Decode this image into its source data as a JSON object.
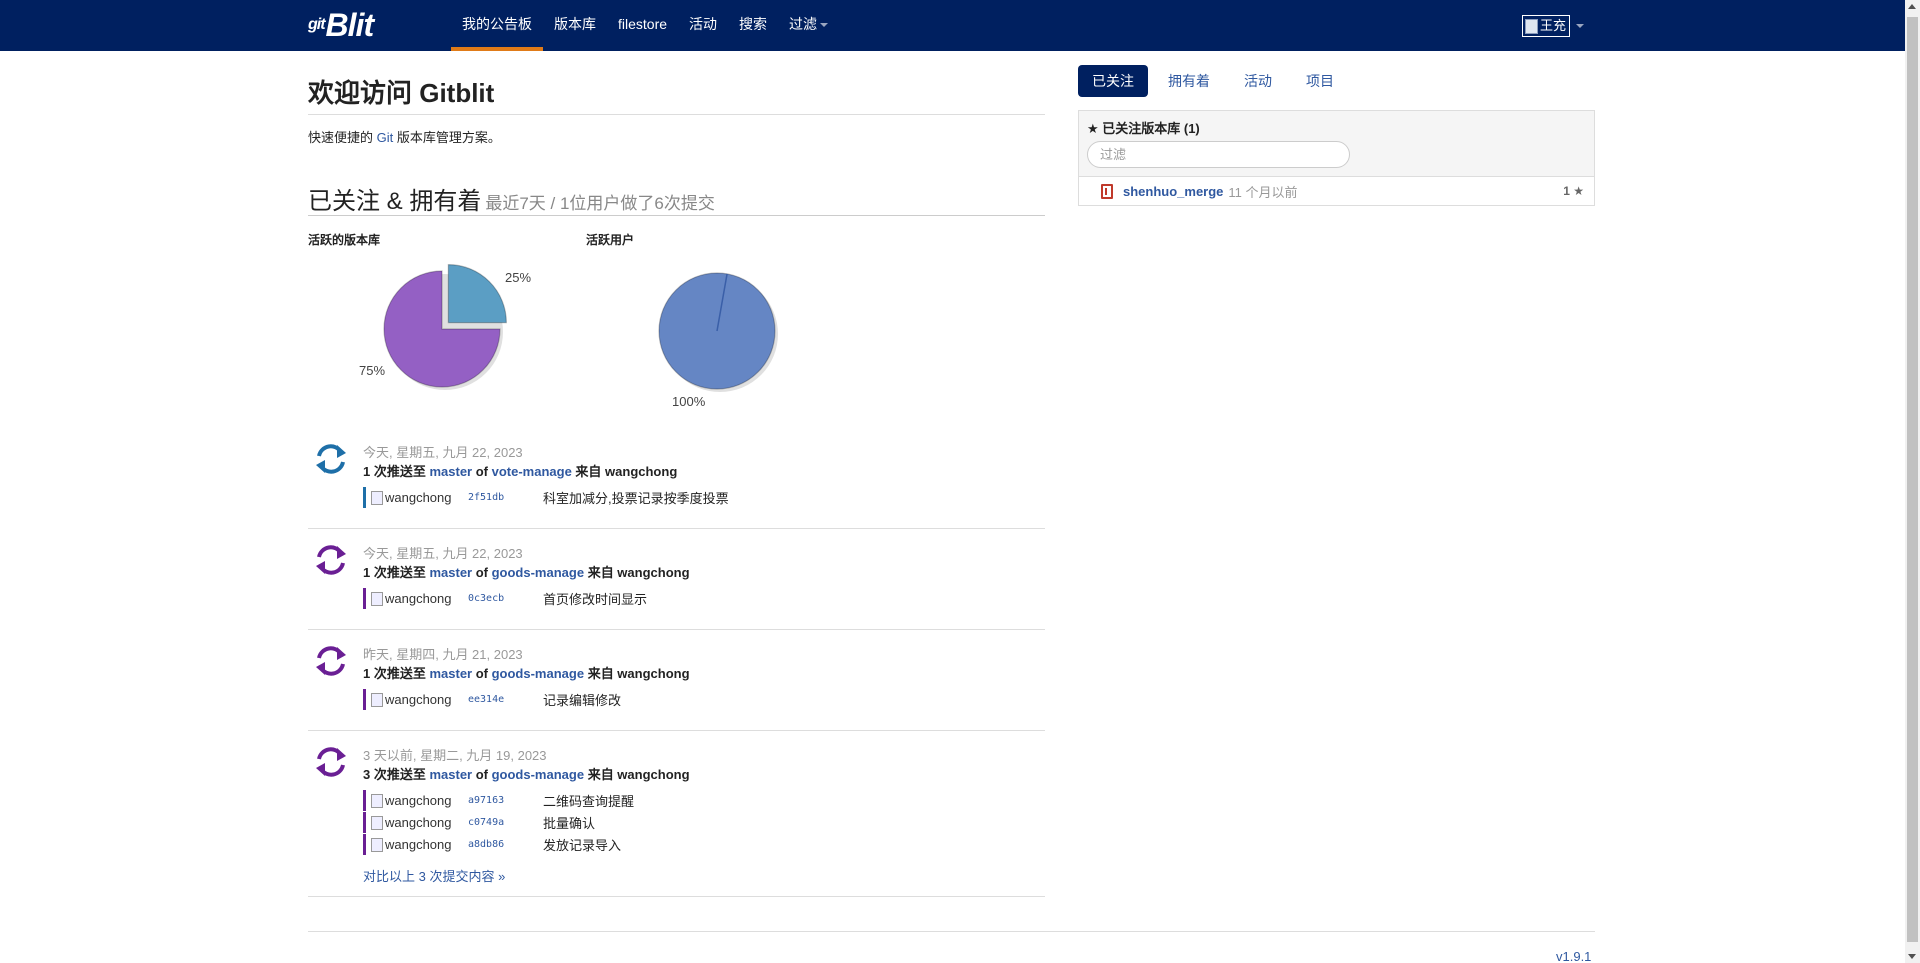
{
  "brand": {
    "prefix": "git",
    "name": "Blit"
  },
  "nav": {
    "items": [
      "我的公告板",
      "版本库",
      "filestore",
      "活动",
      "搜索",
      "过滤"
    ],
    "user_alt": "王充"
  },
  "main": {
    "title": "欢迎访问 Gitblit",
    "intro_before": "快速便捷的 ",
    "intro_link": "Git",
    "intro_after": " 版本库管理方案。",
    "section_title": "已关注 & 拥有着",
    "section_sub": "最近7天 / 1位用户做了6次提交"
  },
  "chart_data": [
    {
      "type": "pie",
      "title": "活跃的版本库",
      "labels": [
        "75%",
        "25%"
      ],
      "values": [
        75,
        25
      ],
      "colors": [
        "#9460c4",
        "#5b9ec4"
      ]
    },
    {
      "type": "pie",
      "title": "活跃用户",
      "labels": [
        "100%"
      ],
      "values": [
        100
      ],
      "colors": [
        "#6586c4"
      ]
    }
  ],
  "activities": [
    {
      "date": "今天, 星期五, 九月 22, 2023",
      "count": "1 次推送至 ",
      "branch": "master",
      "of": " of ",
      "repo": "vote-manage",
      "from": " 来自 wangchong",
      "color": "#1e6fa8",
      "commits": [
        {
          "author": "wangchong",
          "sha": "2f51db",
          "msg": "科室加减分,投票记录按季度投票"
        }
      ]
    },
    {
      "date": "今天, 星期五, 九月 22, 2023",
      "count": "1 次推送至 ",
      "branch": "master",
      "of": " of ",
      "repo": "goods-manage",
      "from": " 来自 wangchong",
      "color": "#6a1f94",
      "commits": [
        {
          "author": "wangchong",
          "sha": "0c3ecb",
          "msg": "首页修改时间显示"
        }
      ]
    },
    {
      "date": "昨天, 星期四, 九月 21, 2023",
      "count": "1 次推送至 ",
      "branch": "master",
      "of": " of ",
      "repo": "goods-manage",
      "from": " 来自 wangchong",
      "color": "#6a1f94",
      "commits": [
        {
          "author": "wangchong",
          "sha": "ee314e",
          "msg": "记录编辑修改"
        }
      ]
    },
    {
      "date": "3 天以前, 星期二, 九月 19, 2023",
      "count": "3 次推送至 ",
      "branch": "master",
      "of": " of ",
      "repo": "goods-manage",
      "from": " 来自 wangchong",
      "color": "#6a1f94",
      "commits": [
        {
          "author": "wangchong",
          "sha": "a97163",
          "msg": "二维码查询提醒"
        },
        {
          "author": "wangchong",
          "sha": "c0749a",
          "msg": "批量确认"
        },
        {
          "author": "wangchong",
          "sha": "a8db86",
          "msg": "发放记录导入"
        }
      ]
    }
  ],
  "compare_link": "对比以上 3 次提交内容 »",
  "sidebar": {
    "tabs": [
      "已关注",
      "拥有着",
      "活动",
      "项目"
    ],
    "box_title": "★ 已关注版本库 (1)",
    "filter_placeholder": "过滤",
    "repos": [
      {
        "name": "shenhuo_merge",
        "time": "11 个月以前",
        "stars": "1 ★"
      }
    ]
  },
  "footer": {
    "version": "v1.9.1"
  }
}
